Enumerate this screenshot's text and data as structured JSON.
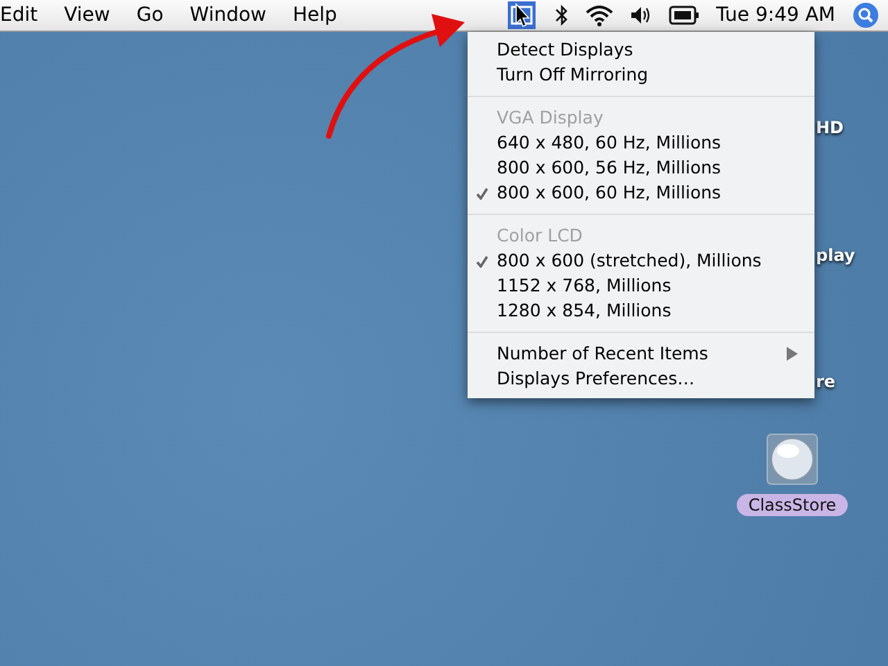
{
  "menubar": {
    "menus": [
      "Edit",
      "View",
      "Go",
      "Window",
      "Help"
    ],
    "clock": "Tue 9:49 AM"
  },
  "display_menu": {
    "items": [
      {
        "kind": "item",
        "label": "Detect Displays",
        "checked": false
      },
      {
        "kind": "item",
        "label": "Turn Off Mirroring",
        "checked": false
      },
      {
        "kind": "separator"
      },
      {
        "kind": "header",
        "label": "VGA Display"
      },
      {
        "kind": "item",
        "label": "640 x 480, 60 Hz, Millions",
        "checked": false
      },
      {
        "kind": "item",
        "label": "800 x 600, 56 Hz, Millions",
        "checked": false
      },
      {
        "kind": "item",
        "label": "800 x 600, 60 Hz, Millions",
        "checked": true
      },
      {
        "kind": "separator"
      },
      {
        "kind": "header",
        "label": "Color LCD"
      },
      {
        "kind": "item",
        "label": "800 x 600 (stretched), Millions",
        "checked": true
      },
      {
        "kind": "item",
        "label": "1152 x 768, Millions",
        "checked": false
      },
      {
        "kind": "item",
        "label": "1280 x 854, Millions",
        "checked": false
      },
      {
        "kind": "separator"
      },
      {
        "kind": "submenu",
        "label": "Number of Recent Items"
      },
      {
        "kind": "item",
        "label": "Displays Preferences…",
        "checked": false
      }
    ]
  },
  "desktop": {
    "partial_labels": [
      "HD",
      "play",
      "re"
    ],
    "icons": [
      {
        "label": "ClassStore",
        "selected": true
      }
    ]
  }
}
